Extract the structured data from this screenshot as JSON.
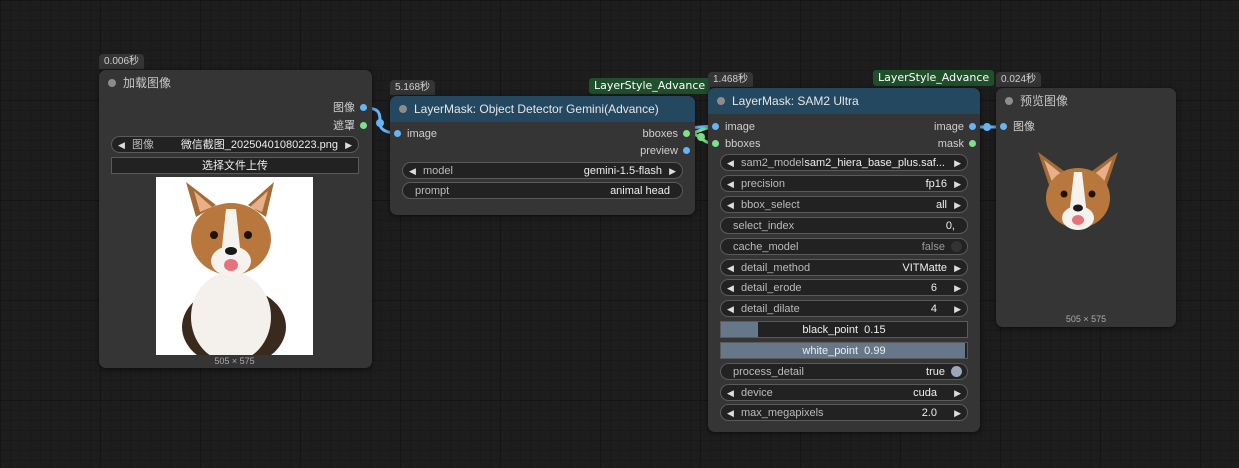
{
  "colors": {
    "node_bg": "#353535",
    "header_blue": "#244860",
    "tag_green": "#1f4f2b",
    "pin_image": "#64b5f6",
    "pin_mask": "#7fe08a"
  },
  "load_node": {
    "time": "0.006秒",
    "title": "加载图像",
    "outputs": [
      "图像",
      "遮罩"
    ],
    "image_widget": {
      "label": "图像",
      "value": "微信截图_20250401080223.png"
    },
    "upload_button": "选择文件上传",
    "image_size": "505 × 575"
  },
  "detector_node": {
    "time": "5.168秒",
    "tag": "LayerStyle_Advance",
    "title": "LayerMask: Object Detector Gemini(Advance)",
    "input": "image",
    "outputs": [
      "bboxes",
      "preview"
    ],
    "model": {
      "label": "model",
      "value": "gemini-1.5-flash"
    },
    "prompt": {
      "label": "prompt",
      "value": "animal head"
    }
  },
  "sam_node": {
    "time": "1.468秒",
    "tag": "LayerStyle_Advance",
    "title": "LayerMask: SAM2 Ultra",
    "inputs": [
      "image",
      "bboxes"
    ],
    "outputs": [
      "image",
      "mask"
    ],
    "sam2_model": {
      "label": "sam2_model",
      "value": "sam2_hiera_base_plus.saf..."
    },
    "precision": {
      "label": "precision",
      "value": "fp16"
    },
    "bbox_select": {
      "label": "bbox_select",
      "value": "all"
    },
    "select_index": {
      "label": "select_index",
      "value": "0,"
    },
    "cache_model": {
      "label": "cache_model",
      "value": "false"
    },
    "detail_method": {
      "label": "detail_method",
      "value": "VITMatte"
    },
    "detail_erode": {
      "label": "detail_erode",
      "value": "6"
    },
    "detail_dilate": {
      "label": "detail_dilate",
      "value": "4"
    },
    "black_point": {
      "label": "black_point",
      "value": "0.15",
      "fraction": 0.15
    },
    "white_point": {
      "label": "white_point",
      "value": "0.99",
      "fraction": 0.99
    },
    "process_detail": {
      "label": "process_detail",
      "value": "true"
    },
    "device": {
      "label": "device",
      "value": "cuda"
    },
    "max_megapixels": {
      "label": "max_megapixels",
      "value": "2.0"
    }
  },
  "preview_node": {
    "time": "0.024秒",
    "title": "预览图像",
    "input": "图像",
    "image_size": "505 × 575"
  }
}
